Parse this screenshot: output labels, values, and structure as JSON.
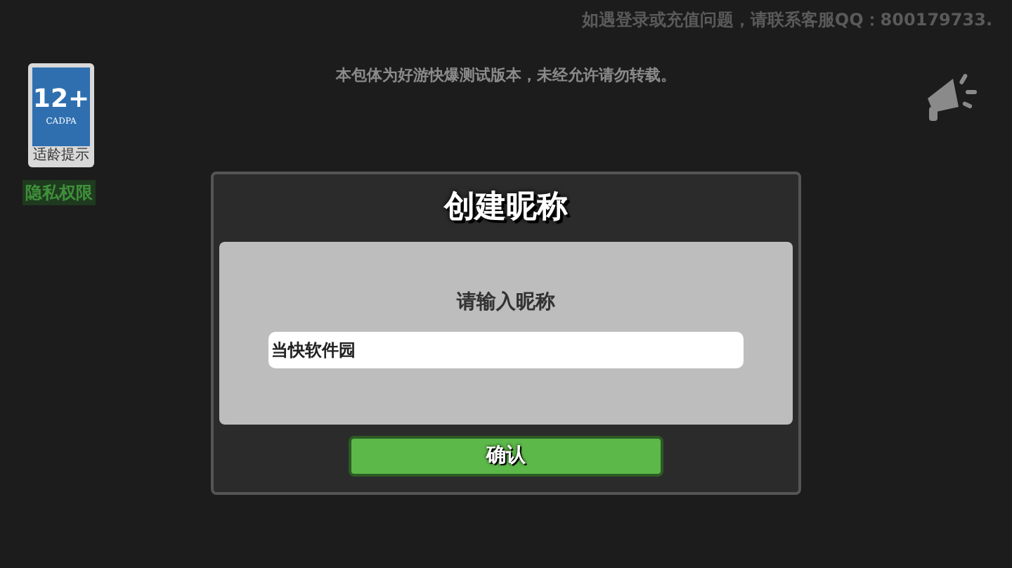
{
  "top_notice": "如遇登录或充值问题，请联系客服QQ：800179733.",
  "disclaimer": "本包体为好游快爆测试版本，未经允许请勿转载。",
  "age_badge": {
    "rating": "12+",
    "org": "CADPA",
    "caption": "适龄提示"
  },
  "privacy_link": "隐私权限",
  "dialog": {
    "title": "创建昵称",
    "prompt": "请输入昵称",
    "field": {
      "value": "当快软件园"
    },
    "confirm_button": "确认"
  }
}
